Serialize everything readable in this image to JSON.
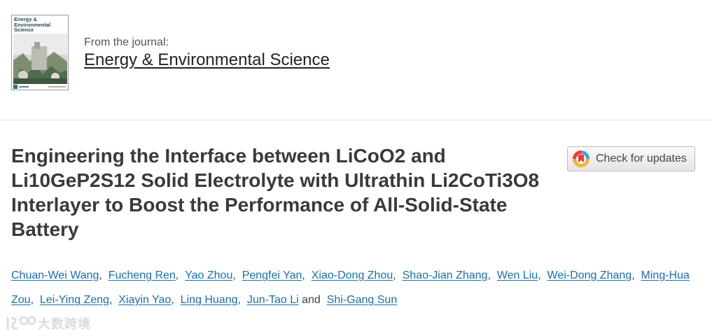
{
  "journal": {
    "cover_title": "Energy & Environmental Science",
    "from_label": "From the journal:",
    "name": "Energy & Environmental Science"
  },
  "article": {
    "title": "Engineering the Interface between LiCoO2 and Li10GeP2S12 Solid Electrolyte with Ultrathin Li2CoTi3O8 Interlayer to Boost the Performance of All-Solid-State Battery"
  },
  "updates_button": {
    "label": "Check for updates",
    "icon": "crossmark-icon"
  },
  "authors": [
    "Chuan-Wei Wang",
    "Fucheng Ren",
    "Yao Zhou",
    "Pengfei Yan",
    "Xiao-Dong Zhou",
    "Shao-Jian Zhang",
    "Wen Liu",
    "Wei-Dong Zhang",
    "Ming-Hua Zou",
    "Lei-Ying Zeng",
    "Xiayin Yao",
    "Ling Huang",
    "Jun-Tao Li",
    "Shi-Gang Sun"
  ],
  "author_separator": ",",
  "author_conjunction": "and",
  "watermark": {
    "text": "大数跨境"
  },
  "colors": {
    "link": "#1a6fa8",
    "title": "#3a3a3a",
    "journal_link": "#222222"
  }
}
